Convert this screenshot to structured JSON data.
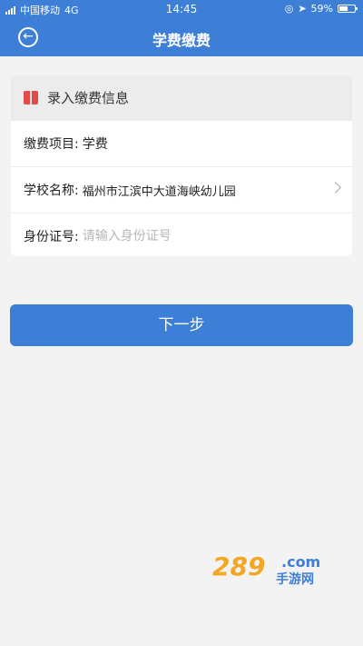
{
  "status_bar": {
    "carrier": "中国移动",
    "network": "4G",
    "time": "14:45",
    "battery": "59%",
    "battery_level": 0.59
  },
  "nav": {
    "title": "学费缴费"
  },
  "form_card": {
    "header": "录入缴费信息",
    "item": {
      "label": "缴费项目:",
      "value": "学费"
    },
    "school": {
      "label": "学校名称:",
      "value": "福州市江滨中大道海峡幼儿园"
    },
    "id_number": {
      "label": "身份证号:",
      "value": "",
      "placeholder": "请输入身份证号"
    }
  },
  "next_button": "下一步",
  "watermark": {
    "number": "289",
    "domain": ".com",
    "text": "手游网"
  },
  "colors": {
    "primary": "#3d7fd6",
    "header_icon": "#e34a4a",
    "watermark_orange": "#f5a623"
  },
  "icons": [
    "signal-icon",
    "back-arrow-icon",
    "book-icon",
    "chevron-right-icon",
    "battery-icon"
  ]
}
